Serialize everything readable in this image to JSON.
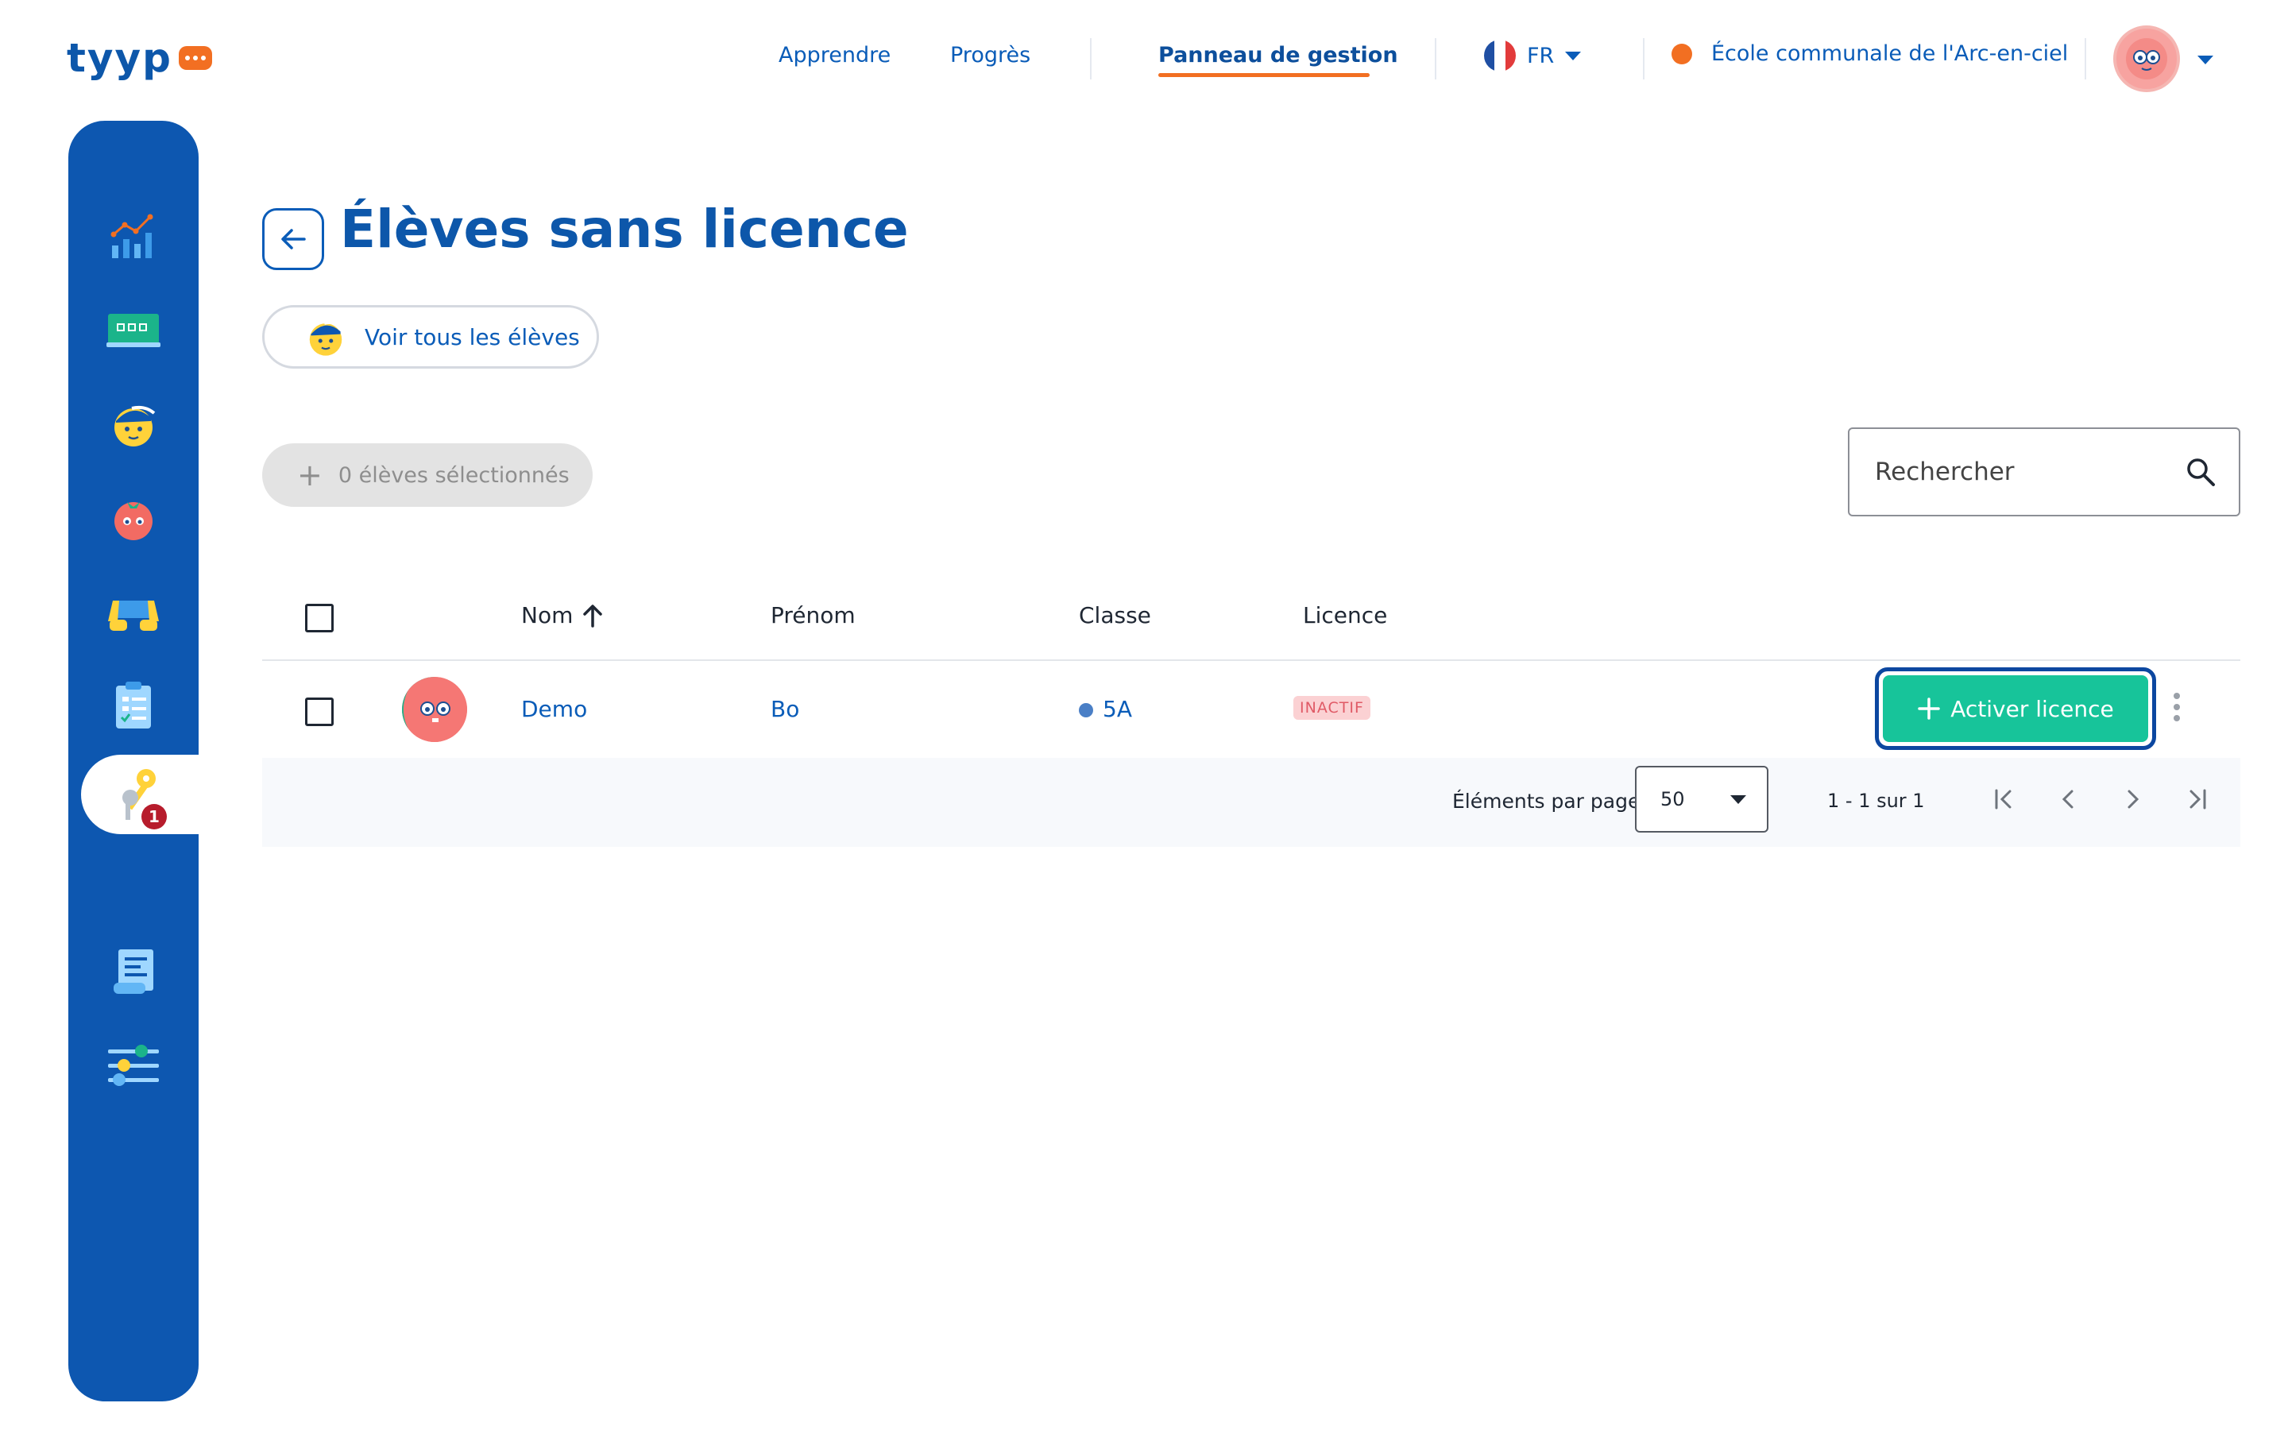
{
  "app": {
    "logo_text": "tyyp",
    "brand_color": "#0d57aa",
    "accent_color": "#f26f22"
  },
  "nav": {
    "learn": "Apprendre",
    "progress": "Progrès",
    "dashboard": "Panneau de gestion",
    "language": "FR",
    "school": "École communale de l'Arc-en-ciel"
  },
  "sidebar": {
    "items": [
      {
        "icon": "chart-icon"
      },
      {
        "icon": "classroom-icon"
      },
      {
        "icon": "student-icon"
      },
      {
        "icon": "tomato-icon"
      },
      {
        "icon": "keyboard-hands-icon"
      },
      {
        "icon": "checklist-icon"
      },
      {
        "icon": "keys-icon",
        "active": true,
        "badge": "1"
      },
      {
        "icon": "invoice-icon"
      },
      {
        "icon": "settings-sliders-icon"
      }
    ]
  },
  "page": {
    "title": "Élèves sans licence",
    "view_all_label": "Voir tous les élèves",
    "selected_label": "0 élèves sélectionnés",
    "search_placeholder": "Rechercher"
  },
  "table": {
    "columns": [
      "Nom",
      "Prénom",
      "Classe",
      "Licence"
    ],
    "sort_column": "Nom",
    "sort_direction": "asc",
    "rows": [
      {
        "nom": "Demo",
        "prenom": "Bo",
        "classe": "5A",
        "licence": "INACTIF",
        "action_label": "Activer licence"
      }
    ]
  },
  "pagination": {
    "per_page_label": "Éléments par page",
    "per_page_value": "50",
    "range_label": "1 - 1 sur 1"
  }
}
